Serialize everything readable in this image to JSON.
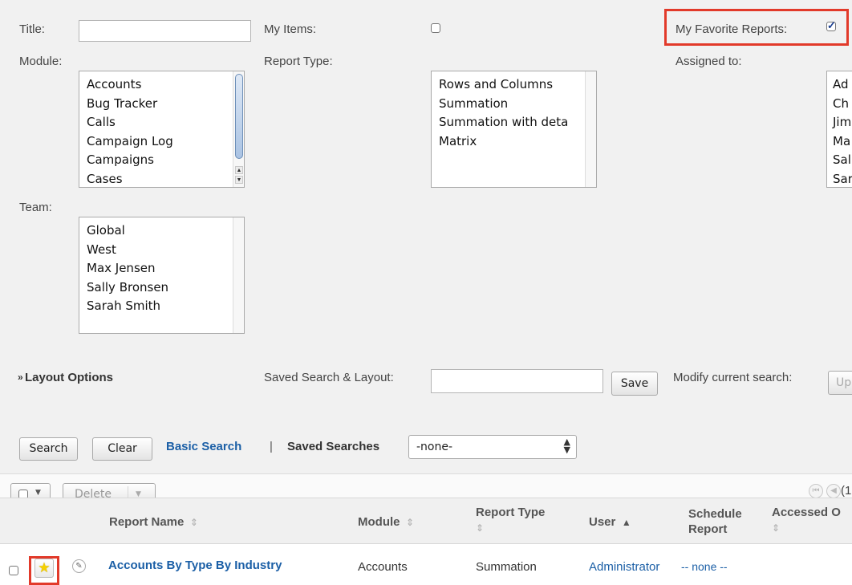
{
  "filter": {
    "title_label": "Title:",
    "title_value": "",
    "my_items_label": "My Items:",
    "my_items_checked": false,
    "my_favorites_label": "My Favorite Reports:",
    "my_favorites_checked": true,
    "module_label": "Module:",
    "module_options": [
      "Accounts",
      "Bug Tracker",
      "Calls",
      "Campaign Log",
      "Campaigns",
      "Cases"
    ],
    "report_type_label": "Report Type:",
    "report_type_options": [
      "Rows and Columns",
      "Summation",
      "Summation with deta",
      "Matrix"
    ],
    "assigned_label": "Assigned to:",
    "assigned_options": [
      "Ad",
      "Ch",
      "Jim",
      "Ma",
      "Sal",
      "Sar"
    ],
    "team_label": "Team:",
    "team_options": [
      "Global",
      "West",
      "Max Jensen",
      "Sally Bronsen",
      "Sarah Smith"
    ],
    "layout_options_label": "Layout Options",
    "layout_options_icon": "double-chevron-down-icon",
    "saved_search_layout_label": "Saved Search & Layout:",
    "saved_search_name_value": "",
    "save_label": "Save",
    "modify_label": "Modify current search:",
    "update_label_partial": "Up",
    "search_label": "Search",
    "clear_label": "Clear",
    "basic_search_label": "Basic Search",
    "separator": "|",
    "saved_searches_label": "Saved Searches",
    "saved_searches_value": "-none-"
  },
  "toolbar": {
    "delete_label": "Delete",
    "pagination_partial": "(1"
  },
  "table": {
    "columns": {
      "report_name": "Report Name",
      "module": "Module",
      "report_type_line1": "Report Type",
      "user": "User",
      "schedule_line1": "Schedule",
      "schedule_line2": "Report",
      "accessed_partial": "Accessed O"
    },
    "rows": [
      {
        "favorite": true,
        "name": "Accounts By Type By Industry",
        "module": "Accounts",
        "report_type": "Summation",
        "user": "Administrator",
        "schedule": "-- none --"
      }
    ]
  },
  "colors": {
    "highlight": "#e23a2a",
    "link": "#1b5fa6",
    "panel_bg": "#f1f1f1"
  }
}
